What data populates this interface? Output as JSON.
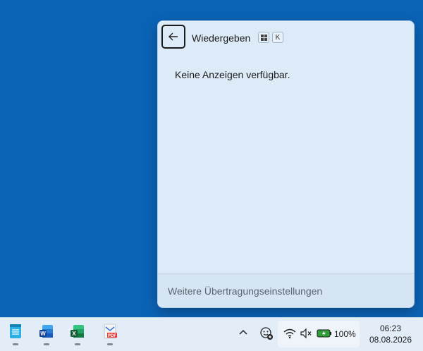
{
  "flyout": {
    "title": "Wiedergeben",
    "shortcut_keys": [
      "⊞",
      "K"
    ],
    "empty_message": "Keine Anzeigen verfügbar.",
    "footer_link": "Weitere Übertragungseinstellungen",
    "back_icon": "arrow-left-icon"
  },
  "taskbar": {
    "apps": [
      {
        "name": "notepad",
        "color": "#1fa3d8"
      },
      {
        "name": "word",
        "color": "#1e5fbf"
      },
      {
        "name": "excel",
        "color": "#1d7a43"
      },
      {
        "name": "pdf-editor",
        "color": "#d83b2f"
      }
    ],
    "tray": {
      "battery_percent": "100%",
      "icons": [
        "chevron-up-icon",
        "emoji-add-icon",
        "wifi-icon",
        "volume-muted-icon",
        "battery-charging-icon"
      ]
    },
    "clock": {
      "time": "06:23",
      "date": "08.08.2026"
    }
  },
  "colors": {
    "desktop": "#0b63b6",
    "flyout_bg": "#dcebf7",
    "taskbar_bg": "#e3edf7"
  }
}
